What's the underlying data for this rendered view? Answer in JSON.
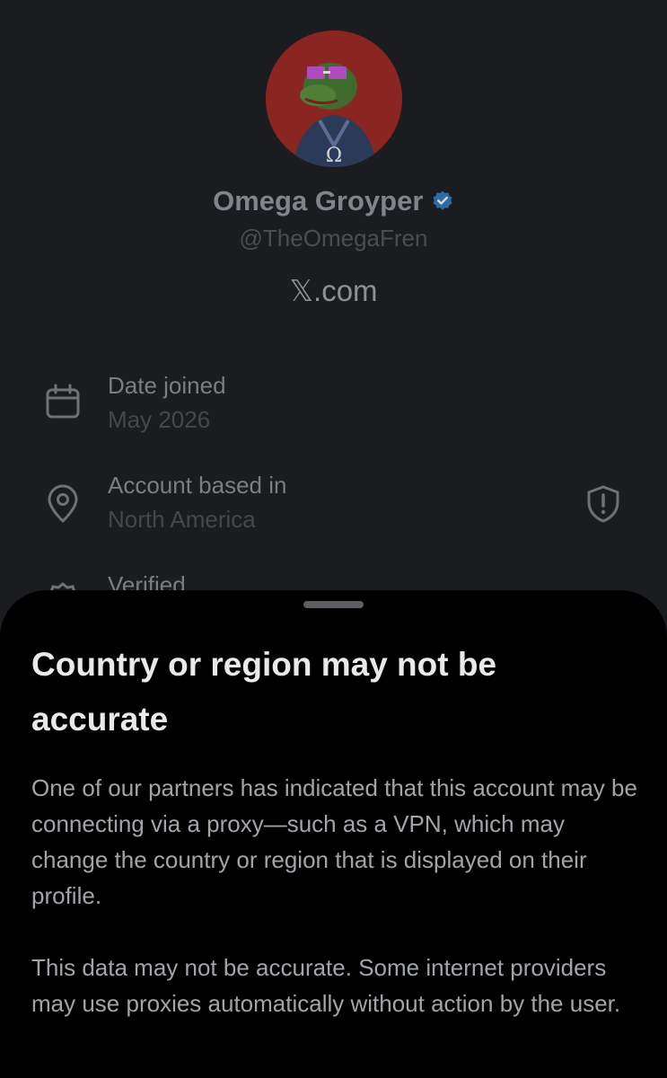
{
  "profile": {
    "display_name": "Omega Groyper",
    "handle": "@TheOmegaFren",
    "site": "𝕏.com",
    "avatar_glyph": "Ω",
    "verified": true,
    "verified_color": "#1d9bf0"
  },
  "details": {
    "date_joined": {
      "label": "Date joined",
      "value": "May 2026",
      "icon": "calendar-icon"
    },
    "account_based_in": {
      "label": "Account based in",
      "value": "North America",
      "icon": "location-pin-icon",
      "trailing_icon": "shield-alert-icon"
    },
    "verified": {
      "label": "Verified",
      "icon": "verified-badge-icon"
    }
  },
  "sheet": {
    "title": "Country or region may not be accurate",
    "paragraph_1": "One of our partners has indicated that this account may be connecting via a proxy—such as a VPN, which may change the country or region that is displayed on their profile.",
    "paragraph_2": "This data may not be accurate. Some internet providers may use proxies automatically without action by the user."
  }
}
